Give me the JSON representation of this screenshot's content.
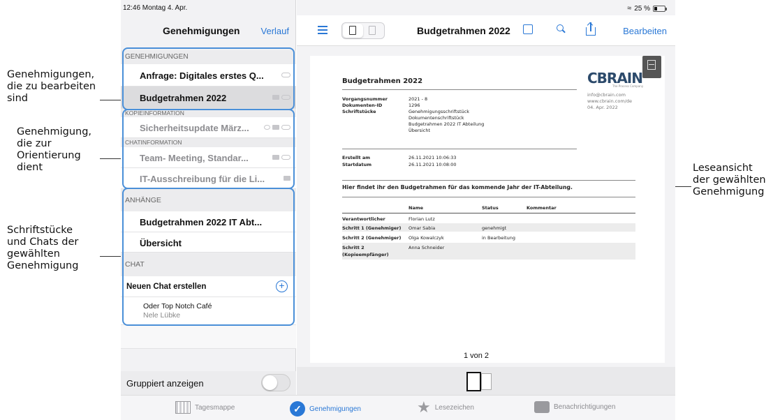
{
  "annotations": {
    "a1": "Genehmigungen,\ndie zu bearbeiten\nsind",
    "a2": "Genehmigung,\ndie zur\nOrientierung\ndient",
    "a3": "Schriftstücke\nund Chats der\ngewählten\nGenehmigung",
    "a4": "Leseansicht\nder gewählten\nGenehmigung"
  },
  "statusbar": {
    "time": "12:46  Montag 4. Apr.",
    "battery": "25 %"
  },
  "left": {
    "title": "Genehmigungen",
    "link": "Verlauf",
    "sections": {
      "genehmigungen": "GENEHMIGUNGEN",
      "kopie": "KOPIEINFORMATION",
      "chatinfo": "CHATINFORMATION",
      "anhaenge": "ANHÄNGE",
      "chat": "CHAT"
    },
    "items": {
      "i1": "Anfrage: Digitales erstes Q...",
      "i2": "Budgetrahmen 2022",
      "i3": "Sicherheitsupdate März...",
      "i4": "Team- Meeting, Standar...",
      "i5": "IT-Ausschreibung für die Li...",
      "a1": "Budgetrahmen 2022 IT Abt...",
      "a2": "Übersicht",
      "newchat": "Neuen Chat erstellen",
      "chat_title": "Oder Top Notch Café",
      "chat_user": "Nele Lübke"
    },
    "group_label": "Gruppiert anzeigen"
  },
  "right": {
    "title": "Budgetrahmen 2022",
    "edit": "Bearbeiten",
    "page": "1 von 2"
  },
  "doc": {
    "title": "Budgetrahmen 2022",
    "logo": "CBRAIN",
    "logo_sub": "The Process Company",
    "contact1": "info@cbrain.com",
    "contact2": "www.cbrain.com/de",
    "contact3": "04. Apr. 2022",
    "k1": "Vorgangsnummer",
    "v1": "2021 - 8",
    "k2": "Dokumenten-ID",
    "v2": "1296",
    "k3": "Schriftstücke",
    "v3a": "Genehmigungsschriftstück",
    "v3b": "Dokumentenschriftstück",
    "v3c": "Budgetrahmen 2022 IT Abteilung",
    "v3d": "Übersicht",
    "k4": "Erstellt am",
    "v4": "26.11.2021 10:06:33",
    "k5": "Startdatum",
    "v5": "26.11.2021 10:08:00",
    "intro": "Hier findet ihr den Budgetrahmen für das kommende Jahr der IT-Abteilung.",
    "th_name": "Name",
    "th_status": "Status",
    "th_comment": "Kommentar",
    "r1k": "Verantwortlicher",
    "r1n": "Florian Lutz",
    "r2k": "Schritt 1 (Genehmiger)",
    "r2n": "Omar Sabia",
    "r2s": "genehmigt",
    "r3k": "Schritt 2 (Genehmiger)",
    "r3n": "Olga Kowalczyk",
    "r3s": "in Bearbeitung",
    "r4k1": "Schritt 2",
    "r4k2": "(Kopieempfänger)",
    "r4n": "Anna Schneider"
  },
  "tabs": {
    "t1": "Tagesmappe",
    "t2": "Genehmigungen",
    "t3": "Lesezeichen",
    "t4": "Benachrichtigungen"
  },
  "colors": {
    "accent": "#2a78d6",
    "highlight": "#4a8fd8"
  }
}
